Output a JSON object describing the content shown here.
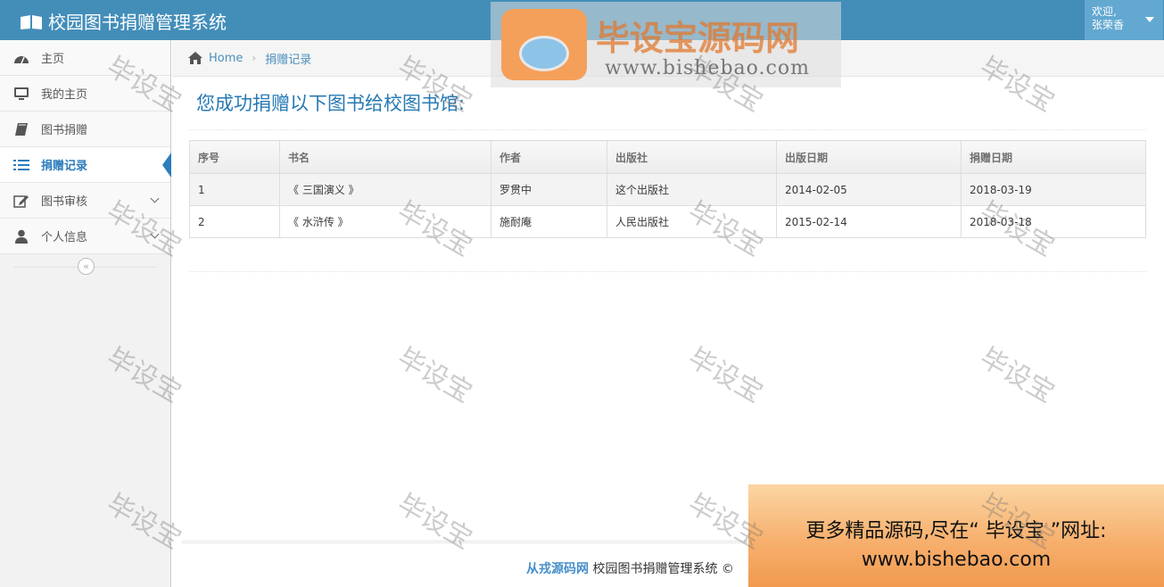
{
  "app": {
    "title": "校园图书捐赠管理系统"
  },
  "user": {
    "greeting": "欢迎,",
    "name": "张荣香"
  },
  "sidebar": {
    "items": [
      {
        "label": "主页",
        "icon": "dashboard-icon"
      },
      {
        "label": "我的主页",
        "icon": "desktop-icon"
      },
      {
        "label": "图书捐赠",
        "icon": "book-icon"
      },
      {
        "label": "捐赠记录",
        "icon": "list-icon",
        "active": true
      },
      {
        "label": "图书审核",
        "icon": "edit-icon",
        "has_submenu": true
      },
      {
        "label": "个人信息",
        "icon": "user-icon",
        "has_submenu": true
      }
    ],
    "collapse_symbol": "«"
  },
  "breadcrumb": {
    "home": "Home",
    "current": "捐赠记录"
  },
  "main": {
    "title": "您成功捐赠以下图书给校图书馆:"
  },
  "table": {
    "headers": [
      "序号",
      "书名",
      "作者",
      "出版社",
      "出版日期",
      "捐赠日期"
    ],
    "rows": [
      [
        "1",
        "《 三国演义 》",
        "罗贯中",
        "这个出版社",
        "2014-02-05",
        "2018-03-19"
      ],
      [
        "2",
        "《 水浒传 》",
        "施耐庵",
        "人民出版社",
        "2015-02-14",
        "2018-03-18"
      ]
    ]
  },
  "footer": {
    "brand": "从戎源码网",
    "text": "校园图书捐赠管理系统 ©"
  },
  "watermark": {
    "text": "毕设宝",
    "logo_name": "毕设宝源码网",
    "logo_url": "www.bishebao.com",
    "badge": "毕设宝"
  },
  "promo": {
    "line1": "更多精品源码,尽在“ 毕设宝 ”网址:",
    "line2": "www.bishebao.com"
  },
  "colors": {
    "navbar": "#438eb9",
    "accent": "#2b7dbc",
    "title": "#2679b5"
  }
}
